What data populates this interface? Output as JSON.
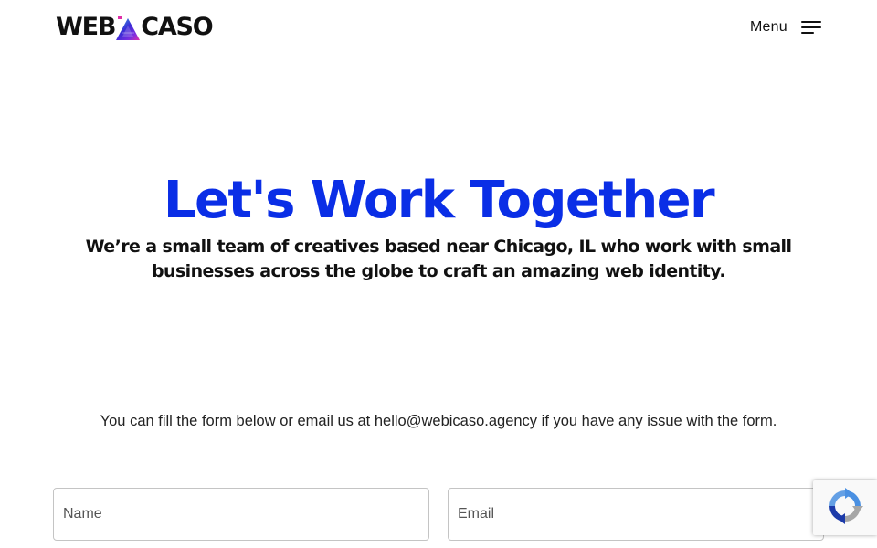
{
  "header": {
    "logo": {
      "part1": "WEB",
      "part2": "CASO",
      "mark_colors": [
        "#3b2bd6",
        "#7a2fe0",
        "#e02fa8",
        "#2fb8e0"
      ]
    },
    "menu_label": "Menu",
    "menu_icon": "hamburger-icon"
  },
  "hero": {
    "title": "Let's Work Together",
    "subtitle": "We’re a small team of creatives based near Chicago, IL who work with small businesses across the globe to craft an amazing web identity."
  },
  "info": {
    "before": "You can fill the form below or email us at ",
    "email": "hello@webicaso.agency",
    "after": " if you have any issue with the form."
  },
  "form": {
    "name_placeholder": "Name",
    "email_placeholder": "Email"
  },
  "recaptcha": {
    "icon": "recaptcha-icon"
  },
  "colors": {
    "accent": "#0a2ee6",
    "text": "#111111",
    "border": "#c4c4c4"
  }
}
